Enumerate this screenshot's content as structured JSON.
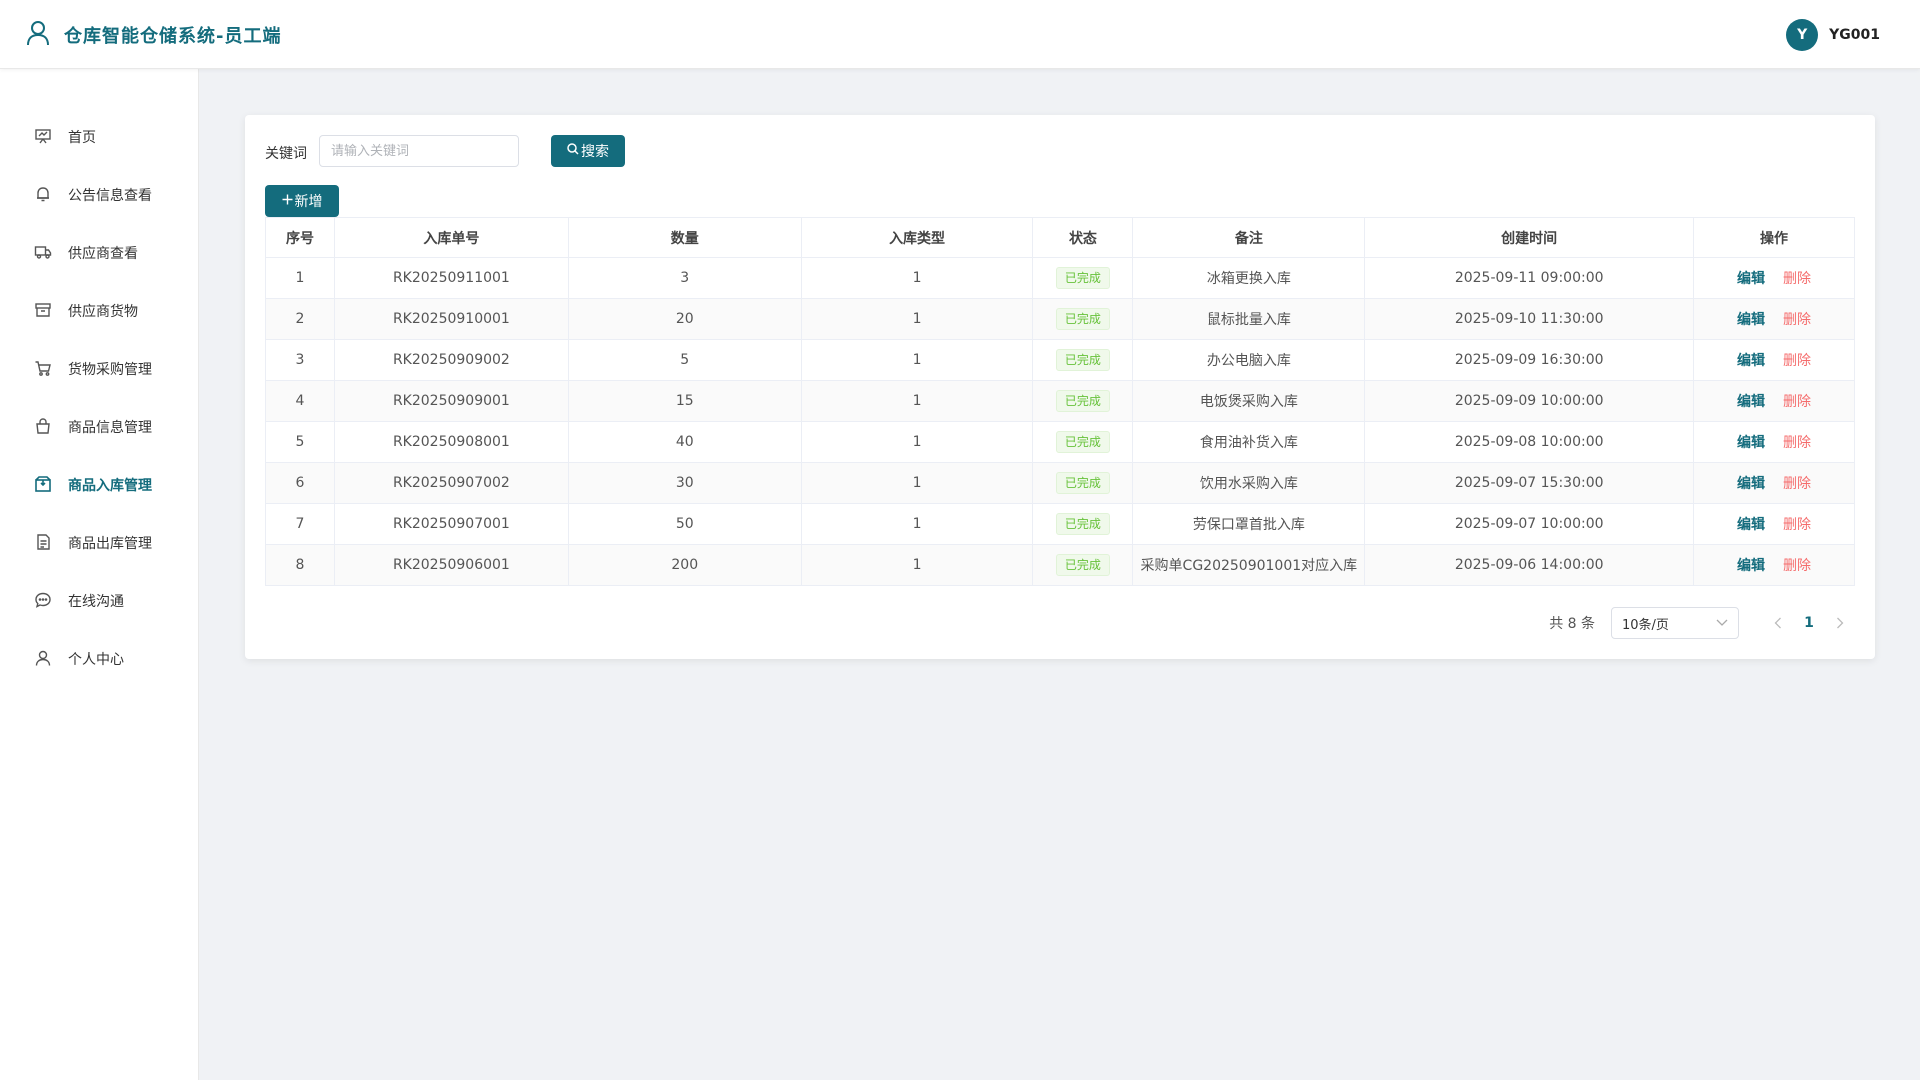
{
  "header": {
    "title": "仓库智能仓储系统-员工端",
    "avatar_letter": "Y",
    "username": "YG001"
  },
  "sidebar": {
    "items": [
      {
        "label": "首页",
        "icon": "home-icon"
      },
      {
        "label": "公告信息查看",
        "icon": "bell-icon"
      },
      {
        "label": "供应商查看",
        "icon": "truck-icon"
      },
      {
        "label": "供应商货物",
        "icon": "box-icon"
      },
      {
        "label": "货物采购管理",
        "icon": "cart-icon"
      },
      {
        "label": "商品信息管理",
        "icon": "bag-icon"
      },
      {
        "label": "商品入库管理",
        "icon": "package-icon",
        "active": true
      },
      {
        "label": "商品出库管理",
        "icon": "document-icon"
      },
      {
        "label": "在线沟通",
        "icon": "chat-icon"
      },
      {
        "label": "个人中心",
        "icon": "user-icon"
      }
    ]
  },
  "search": {
    "label": "关键词",
    "placeholder": "请输入关键词",
    "button_label": "搜索"
  },
  "toolbar": {
    "add_label": "新增"
  },
  "table": {
    "columns": [
      "序号",
      "入库单号",
      "数量",
      "入库类型",
      "状态",
      "备注",
      "创建时间",
      "操作"
    ],
    "edit_label": "编辑",
    "delete_label": "删除",
    "rows": [
      {
        "index": "1",
        "order_no": "RK20250911001",
        "quantity": "3",
        "type": "1",
        "status": "已完成",
        "remark": "冰箱更换入库",
        "created": "2025-09-11 09:00:00"
      },
      {
        "index": "2",
        "order_no": "RK20250910001",
        "quantity": "20",
        "type": "1",
        "status": "已完成",
        "remark": "鼠标批量入库",
        "created": "2025-09-10 11:30:00"
      },
      {
        "index": "3",
        "order_no": "RK20250909002",
        "quantity": "5",
        "type": "1",
        "status": "已完成",
        "remark": "办公电脑入库",
        "created": "2025-09-09 16:30:00"
      },
      {
        "index": "4",
        "order_no": "RK20250909001",
        "quantity": "15",
        "type": "1",
        "status": "已完成",
        "remark": "电饭煲采购入库",
        "created": "2025-09-09 10:00:00"
      },
      {
        "index": "5",
        "order_no": "RK20250908001",
        "quantity": "40",
        "type": "1",
        "status": "已完成",
        "remark": "食用油补货入库",
        "created": "2025-09-08 10:00:00"
      },
      {
        "index": "6",
        "order_no": "RK20250907002",
        "quantity": "30",
        "type": "1",
        "status": "已完成",
        "remark": "饮用水采购入库",
        "created": "2025-09-07 15:30:00"
      },
      {
        "index": "7",
        "order_no": "RK20250907001",
        "quantity": "50",
        "type": "1",
        "status": "已完成",
        "remark": "劳保口罩首批入库",
        "created": "2025-09-07 10:00:00"
      },
      {
        "index": "8",
        "order_no": "RK20250906001",
        "quantity": "200",
        "type": "1",
        "status": "已完成",
        "remark": "采购单CG20250901001对应入库",
        "created": "2025-09-06 14:00:00"
      }
    ]
  },
  "pagination": {
    "total_text": "共 8 条",
    "page_size": "10条/页",
    "current_page": "1"
  },
  "colors": {
    "primary": "#146c7d",
    "success": "#67c23a",
    "danger": "#f56c6c"
  }
}
